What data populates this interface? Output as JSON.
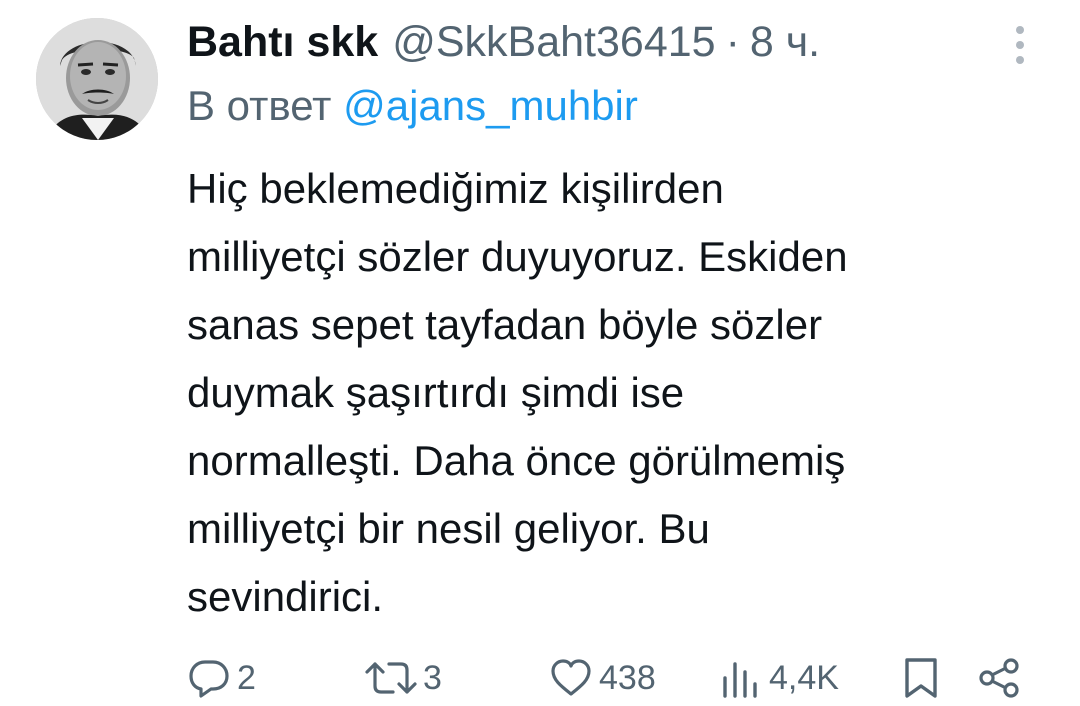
{
  "tweet": {
    "display_name": "Bahtı skk",
    "handle": "@SkkBaht36415",
    "separator": "·",
    "time": "8 ч.",
    "reply_prefix": "В ответ",
    "reply_mention": "@ajans_muhbir",
    "text_lines": [
      "Hiç beklemediğimiz kişilirden",
      "milliyetçi sözler duyuyoruz. Eskiden",
      "sanas sepet tayfadan böyle sözler",
      "duymak şaşırtırdı şimdi ise",
      "normalleşti. Daha önce görülmemiş",
      "milliyetçi bir nesil geliyor. Bu",
      "sevindirici."
    ]
  },
  "actions": {
    "reply": {
      "icon": "reply-icon",
      "count": "2"
    },
    "retweet": {
      "icon": "retweet-icon",
      "count": "3"
    },
    "like": {
      "icon": "heart-icon",
      "count": "438"
    },
    "views": {
      "icon": "views-icon",
      "count": "4,4K"
    },
    "bookmark": {
      "icon": "bookmark-icon"
    },
    "share": {
      "icon": "share-icon"
    }
  },
  "colors": {
    "text": "#0f1419",
    "secondary": "#536471",
    "accent": "#1d9bf0",
    "background": "#ffffff"
  }
}
